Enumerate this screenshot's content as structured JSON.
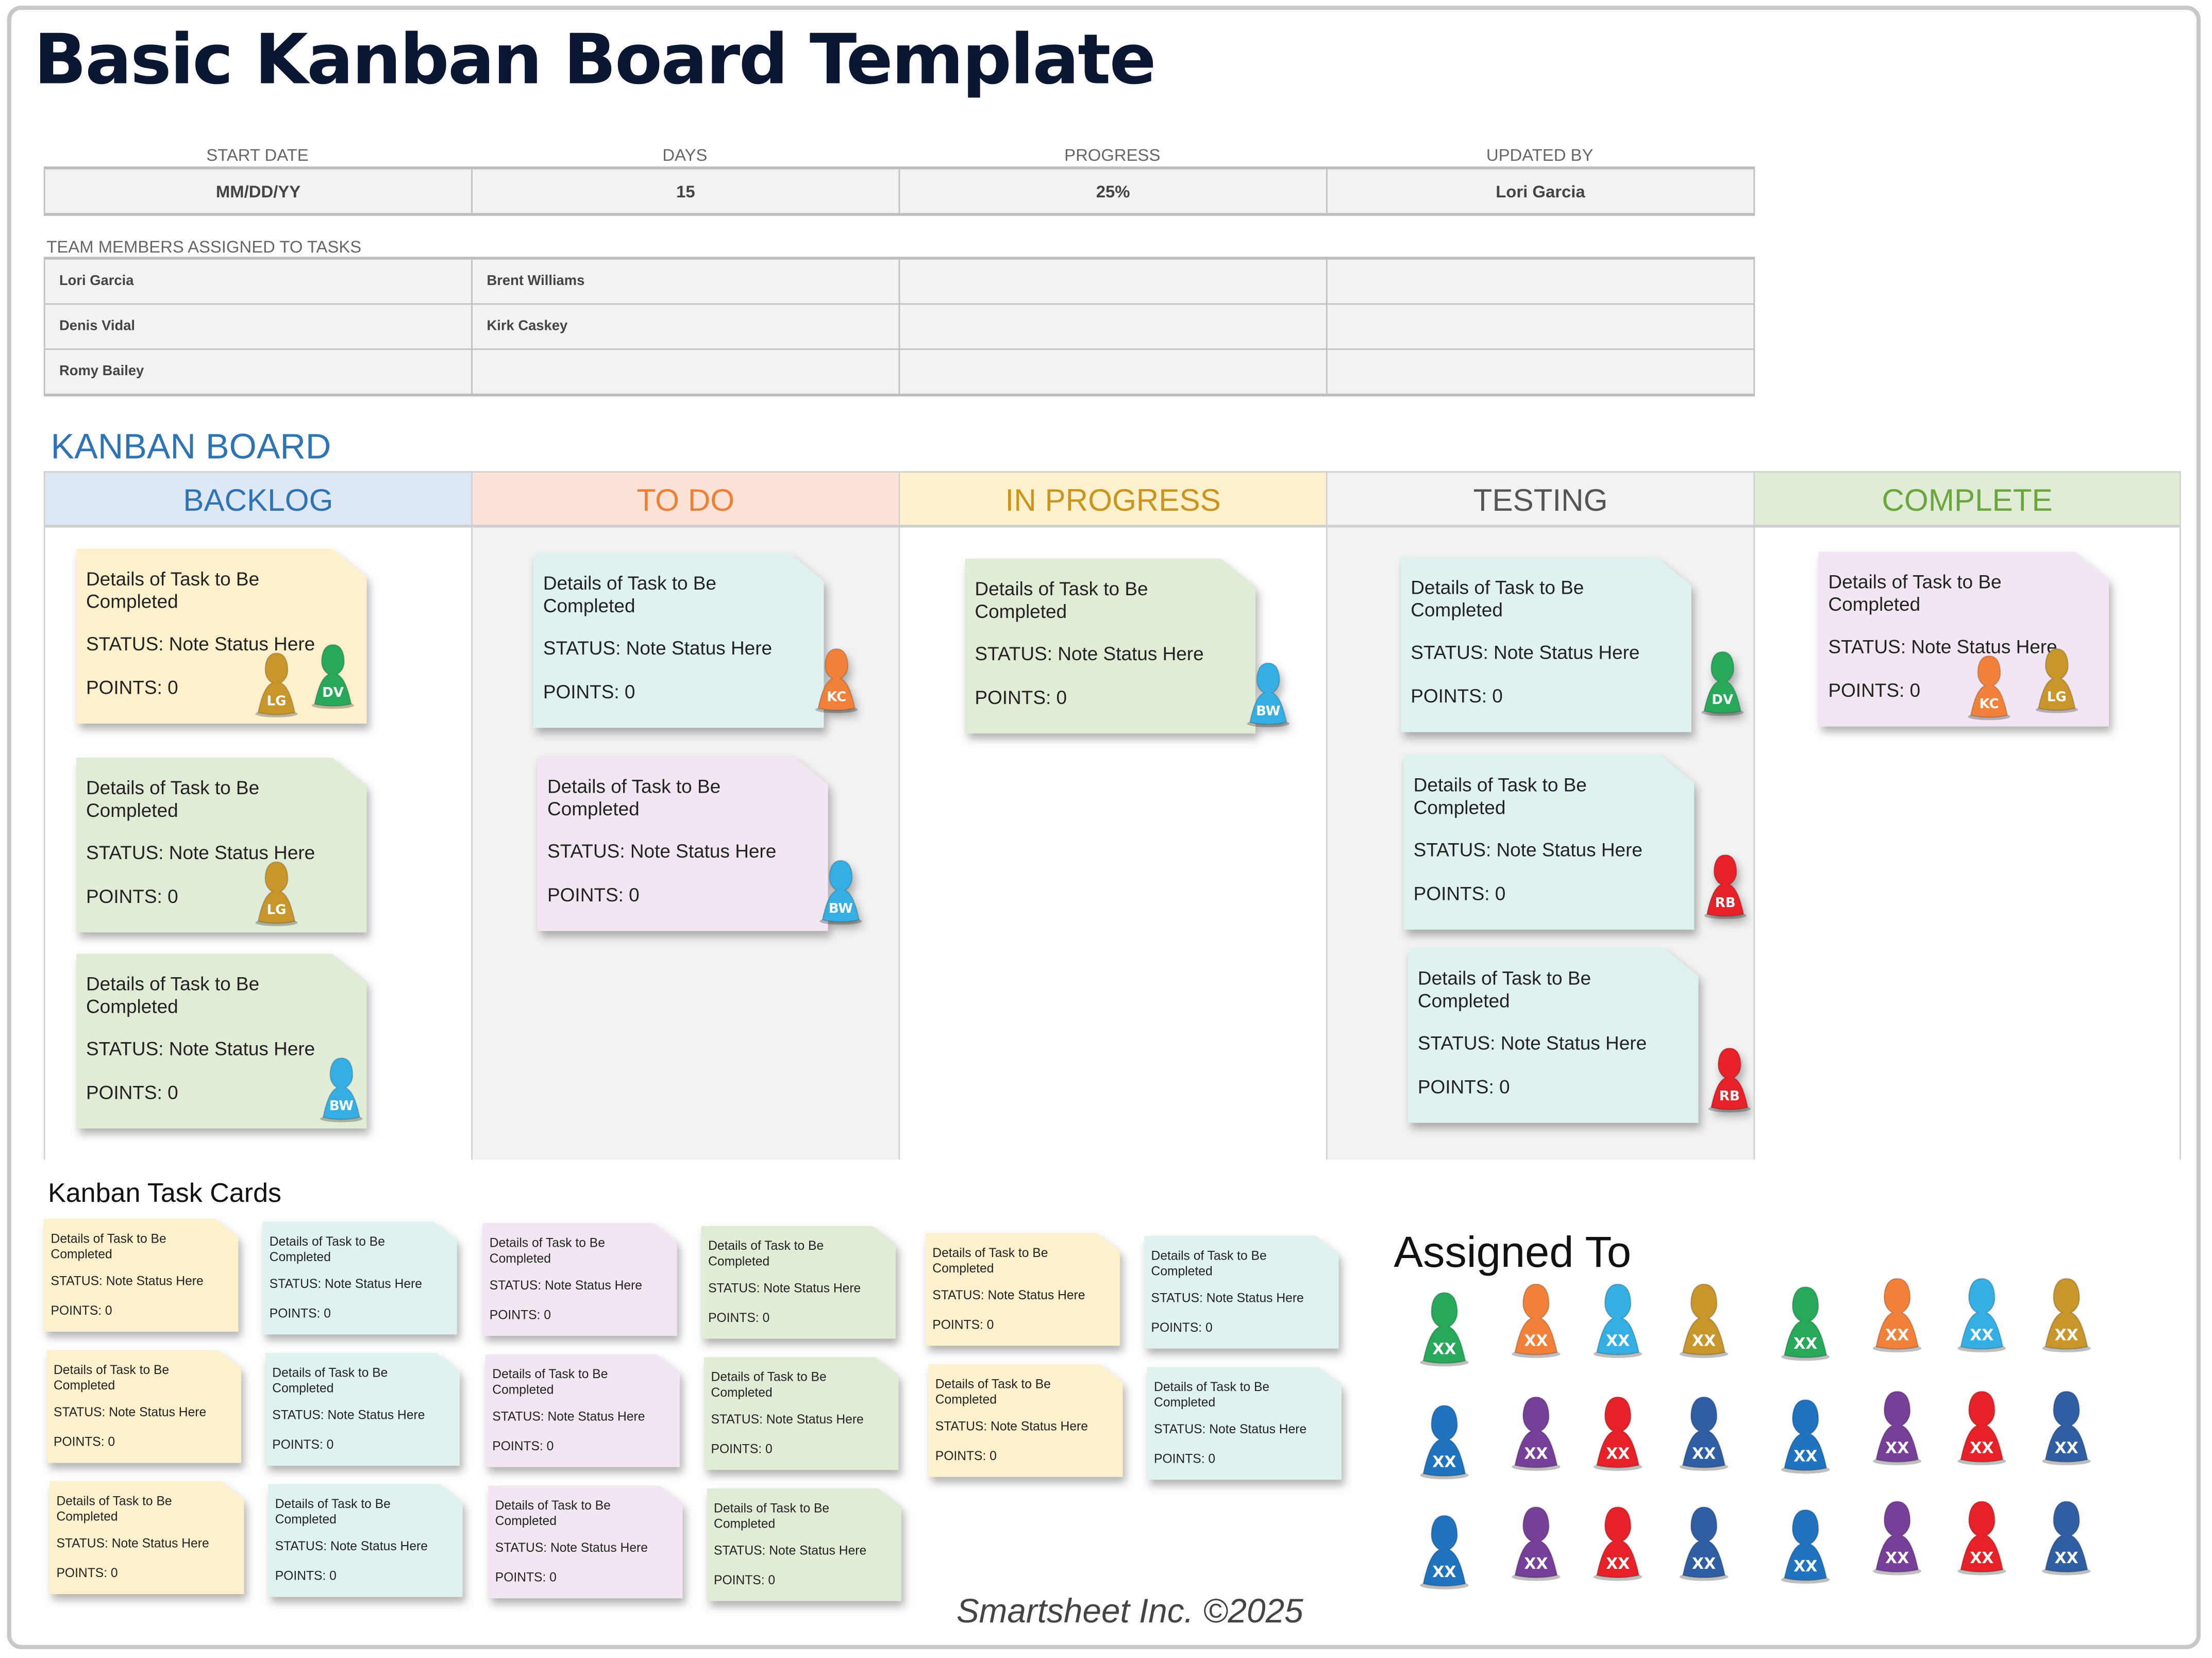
{
  "title": "Basic Kanban Board Template",
  "summary": {
    "headers": [
      "START DATE",
      "DAYS",
      "PROGRESS",
      "UPDATED BY"
    ],
    "values": [
      "MM/DD/YY",
      "15",
      "25%",
      "Lori Garcia"
    ]
  },
  "team": {
    "label": "TEAM MEMBERS ASSIGNED TO TASKS",
    "rows": [
      [
        "Lori Garcia",
        "Brent Williams",
        "",
        ""
      ],
      [
        "Denis Vidal",
        "Kirk Caskey",
        "",
        ""
      ],
      [
        "Romy Bailey",
        "",
        "",
        ""
      ]
    ]
  },
  "board": {
    "title": "KANBAN BOARD",
    "columns": [
      {
        "name": "BACKLOG",
        "header_bg": "#dde8f4",
        "header_color": "#2e74b5",
        "body_bg": "#ffffff",
        "cards": [
          {
            "details": "Details of Task to Be Completed",
            "status": "STATUS: Note Status Here",
            "points": "POINTS: 0",
            "color": "#fdf0cc",
            "assignees": [
              {
                "initials": "LG",
                "color": "#c8962a"
              },
              {
                "initials": "DV",
                "color": "#27a85a"
              }
            ]
          },
          {
            "details": "Details of Task to Be Completed",
            "status": "STATUS: Note Status Here",
            "points": "POINTS: 0",
            "color": "#e1ecd7",
            "assignees": [
              {
                "initials": "LG",
                "color": "#c8962a"
              }
            ]
          },
          {
            "details": "Details of Task to Be Completed",
            "status": "STATUS: Note Status Here",
            "points": "POINTS: 0",
            "color": "#e1ecd7",
            "assignees": [
              {
                "initials": "BW",
                "color": "#35aee3"
              }
            ]
          }
        ]
      },
      {
        "name": "TO DO",
        "header_bg": "#fbe3d8",
        "header_color": "#f07f35",
        "body_bg": "#f2f2f2",
        "cards": [
          {
            "details": "Details of Task to Be Completed",
            "status": "STATUS: Note Status Here",
            "points": "POINTS: 0",
            "color": "#e0f1f1",
            "assignees": [
              {
                "initials": "KC",
                "color": "#f0803a"
              }
            ]
          },
          {
            "details": "Details of Task to Be Completed",
            "status": "STATUS: Note Status Here",
            "points": "POINTS: 0",
            "color": "#f1e6f1",
            "assignees": [
              {
                "initials": "BW",
                "color": "#35aee3"
              }
            ]
          }
        ]
      },
      {
        "name": "IN PROGRESS",
        "header_bg": "#fdf0cc",
        "header_color": "#c9951f",
        "body_bg": "#ffffff",
        "cards": [
          {
            "details": "Details of Task to Be Completed",
            "status": "STATUS: Note Status Here",
            "points": "POINTS: 0",
            "color": "#e1ecd7",
            "assignees": [
              {
                "initials": "BW",
                "color": "#35aee3"
              }
            ]
          }
        ]
      },
      {
        "name": "TESTING",
        "header_bg": "#f2f2f2",
        "header_color": "#555555",
        "body_bg": "#f2f2f2",
        "cards": [
          {
            "details": "Details of Task to Be Completed",
            "status": "STATUS: Note Status Here",
            "points": "POINTS: 0",
            "color": "#e0f1f1",
            "assignees": [
              {
                "initials": "DV",
                "color": "#27a85a"
              }
            ]
          },
          {
            "details": "Details of Task to Be Completed",
            "status": "STATUS: Note Status Here",
            "points": "POINTS: 0",
            "color": "#e0f1f1",
            "assignees": [
              {
                "initials": "RB",
                "color": "#e62127"
              }
            ]
          },
          {
            "details": "Details of Task to Be Completed",
            "status": "STATUS: Note Status Here",
            "points": "POINTS: 0",
            "color": "#e0f1f1",
            "assignees": [
              {
                "initials": "RB",
                "color": "#e62127"
              }
            ]
          }
        ]
      },
      {
        "name": "COMPLETE",
        "header_bg": "#e1ecd7",
        "header_color": "#6aa63c",
        "body_bg": "#ffffff",
        "cards": [
          {
            "details": "Details of Task to Be Completed",
            "status": "STATUS: Note Status Here",
            "points": "POINTS: 0",
            "color": "#f1e6f1",
            "assignees": [
              {
                "initials": "KC",
                "color": "#f0803a"
              },
              {
                "initials": "LG",
                "color": "#c8962a"
              }
            ]
          }
        ]
      }
    ]
  },
  "task_cards": {
    "title": "Kanban Task Cards",
    "columns": [
      {
        "color": "#fdf0cc",
        "count": 3
      },
      {
        "color": "#e0f1f1",
        "count": 3
      },
      {
        "color": "#f1e6f1",
        "count": 3
      },
      {
        "color": "#e1ecd7",
        "count": 3
      },
      {
        "color": "#fdf0cc",
        "count": 2
      },
      {
        "color": "#e0f1f1",
        "count": 2
      }
    ],
    "details": "Details of Task to Be Completed",
    "status": "STATUS: Note Status Here",
    "points": "POINTS: 0"
  },
  "assigned_to": {
    "title": "Assigned To",
    "rows": [
      [
        {
          "initials": "XX",
          "color": "#27a85a"
        },
        {
          "initials": "XX",
          "color": "#f0803a"
        },
        {
          "initials": "XX",
          "color": "#35aee3"
        },
        {
          "initials": "XX",
          "color": "#c8962a"
        },
        {
          "initials": "XX",
          "color": "#27a85a"
        },
        {
          "initials": "XX",
          "color": "#f0803a"
        },
        {
          "initials": "XX",
          "color": "#35aee3"
        },
        {
          "initials": "XX",
          "color": "#c8962a"
        }
      ],
      [
        {
          "initials": "XX",
          "color": "#1f73bf"
        },
        {
          "initials": "XX",
          "color": "#763f98"
        },
        {
          "initials": "XX",
          "color": "#e62127"
        },
        {
          "initials": "XX",
          "color": "#2f5ea3"
        },
        {
          "initials": "XX",
          "color": "#1f73bf"
        },
        {
          "initials": "XX",
          "color": "#763f98"
        },
        {
          "initials": "XX",
          "color": "#e62127"
        },
        {
          "initials": "XX",
          "color": "#2f5ea3"
        }
      ],
      [
        {
          "initials": "XX",
          "color": "#1f73bf"
        },
        {
          "initials": "XX",
          "color": "#763f98"
        },
        {
          "initials": "XX",
          "color": "#e62127"
        },
        {
          "initials": "XX",
          "color": "#2f5ea3"
        },
        {
          "initials": "XX",
          "color": "#1f73bf"
        },
        {
          "initials": "XX",
          "color": "#763f98"
        },
        {
          "initials": "XX",
          "color": "#e62127"
        },
        {
          "initials": "XX",
          "color": "#2f5ea3"
        }
      ]
    ]
  },
  "footer": "Smartsheet Inc. ©2025"
}
